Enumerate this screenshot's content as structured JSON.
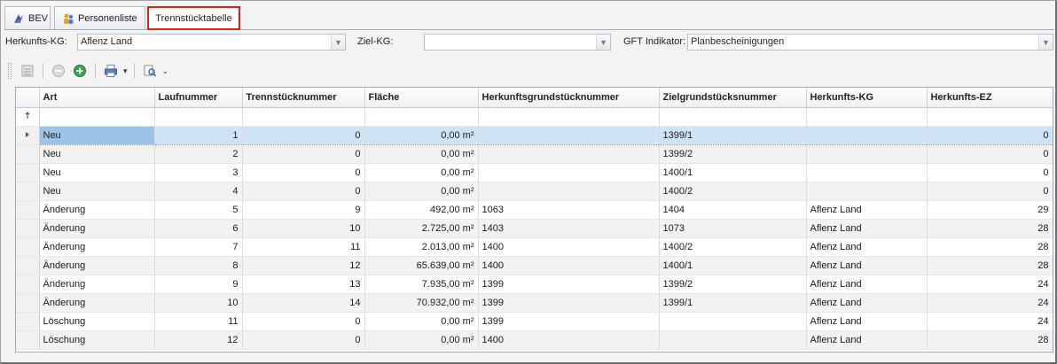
{
  "tabs": [
    {
      "label": "BEV",
      "icon": "bev-icon"
    },
    {
      "label": "Personenliste",
      "icon": "people-icon"
    },
    {
      "label": "Trennstücktabelle",
      "icon": ""
    }
  ],
  "filters": {
    "herkunfts_kg_label": "Herkunfts-KG:",
    "herkunfts_kg_value": "Aflenz Land",
    "ziel_kg_label": "Ziel-KG:",
    "ziel_kg_value": "",
    "gft_label": "GFT Indikator:",
    "gft_value": "Planbescheinigungen"
  },
  "toolbar": {
    "buttons": [
      "list-icon",
      "remove-icon",
      "add-icon",
      "print-icon",
      "filter-search-icon"
    ]
  },
  "columns": [
    "Art",
    "Laufnummer",
    "Trennstücknummer",
    "Fläche",
    "Herkunftsgrundstücknummer",
    "Zielgrundstücksnummer",
    "Herkunfts-KG",
    "Herkunfts-EZ"
  ],
  "rows": [
    {
      "art": "Neu",
      "lauf": "1",
      "trenn": "0",
      "flaeche": "0,00 m²",
      "herkunft": "",
      "ziel": "1399/1",
      "kg": "",
      "ez": "0"
    },
    {
      "art": "Neu",
      "lauf": "2",
      "trenn": "0",
      "flaeche": "0,00 m²",
      "herkunft": "",
      "ziel": "1399/2",
      "kg": "",
      "ez": "0"
    },
    {
      "art": "Neu",
      "lauf": "3",
      "trenn": "0",
      "flaeche": "0,00 m²",
      "herkunft": "",
      "ziel": "1400/1",
      "kg": "",
      "ez": "0"
    },
    {
      "art": "Neu",
      "lauf": "4",
      "trenn": "0",
      "flaeche": "0,00 m²",
      "herkunft": "",
      "ziel": "1400/2",
      "kg": "",
      "ez": "0"
    },
    {
      "art": "Änderung",
      "lauf": "5",
      "trenn": "9",
      "flaeche": "492,00 m²",
      "herkunft": "1063",
      "ziel": "1404",
      "kg": "Aflenz Land",
      "ez": "29"
    },
    {
      "art": "Änderung",
      "lauf": "6",
      "trenn": "10",
      "flaeche": "2.725,00 m²",
      "herkunft": "1403",
      "ziel": "1073",
      "kg": "Aflenz Land",
      "ez": "28"
    },
    {
      "art": "Änderung",
      "lauf": "7",
      "trenn": "11",
      "flaeche": "2.013,00 m²",
      "herkunft": "1400",
      "ziel": "1400/2",
      "kg": "Aflenz Land",
      "ez": "28"
    },
    {
      "art": "Änderung",
      "lauf": "8",
      "trenn": "12",
      "flaeche": "65.639,00 m²",
      "herkunft": "1400",
      "ziel": "1400/1",
      "kg": "Aflenz Land",
      "ez": "28"
    },
    {
      "art": "Änderung",
      "lauf": "9",
      "trenn": "13",
      "flaeche": "7.935,00 m²",
      "herkunft": "1399",
      "ziel": "1399/2",
      "kg": "Aflenz Land",
      "ez": "24"
    },
    {
      "art": "Änderung",
      "lauf": "10",
      "trenn": "14",
      "flaeche": "70.932,00 m²",
      "herkunft": "1399",
      "ziel": "1399/1",
      "kg": "Aflenz Land",
      "ez": "24"
    },
    {
      "art": "Löschung",
      "lauf": "11",
      "trenn": "0",
      "flaeche": "0,00 m²",
      "herkunft": "1399",
      "ziel": "",
      "kg": "Aflenz Land",
      "ez": "24"
    },
    {
      "art": "Löschung",
      "lauf": "12",
      "trenn": "0",
      "flaeche": "0,00 m²",
      "herkunft": "1400",
      "ziel": "",
      "kg": "Aflenz Land",
      "ez": "28"
    }
  ],
  "selected_row": 0,
  "colors": {
    "accent_tab_border": "#d81e1e",
    "selection": "#cfe3f7"
  }
}
